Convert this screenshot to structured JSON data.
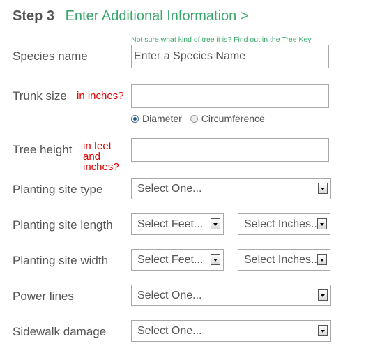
{
  "header": {
    "step": "Step 3",
    "title": "Enter Additional Information >"
  },
  "species": {
    "label": "Species name",
    "tree_key_link": "Not sure what kind of tree it is? Find out in the Tree Key",
    "placeholder": "Enter a Species Name",
    "value": ""
  },
  "trunk": {
    "label": "Trunk size",
    "hint": "in inches?",
    "value": "",
    "radios": [
      {
        "label": "Diameter",
        "checked": true
      },
      {
        "label": "Circumference",
        "checked": false
      }
    ]
  },
  "height": {
    "label": "Tree height",
    "hint_lines": [
      "in feet",
      "and",
      "inches?"
    ],
    "value": ""
  },
  "site_type": {
    "label": "Planting site type",
    "selected": "Select One..."
  },
  "site_length": {
    "label": "Planting site length",
    "feet_selected": "Select Feet...",
    "inches_selected": "Select Inches..."
  },
  "site_width": {
    "label": "Planting site width",
    "feet_selected": "Select Feet...",
    "inches_selected": "Select Inches..."
  },
  "power_lines": {
    "label": "Power lines",
    "selected": "Select One..."
  },
  "sidewalk": {
    "label": "Sidewalk damage",
    "selected": "Select One..."
  },
  "colors": {
    "accent_green": "#3aa86b",
    "hint_red": "#e00000",
    "text_gray": "#555555"
  }
}
